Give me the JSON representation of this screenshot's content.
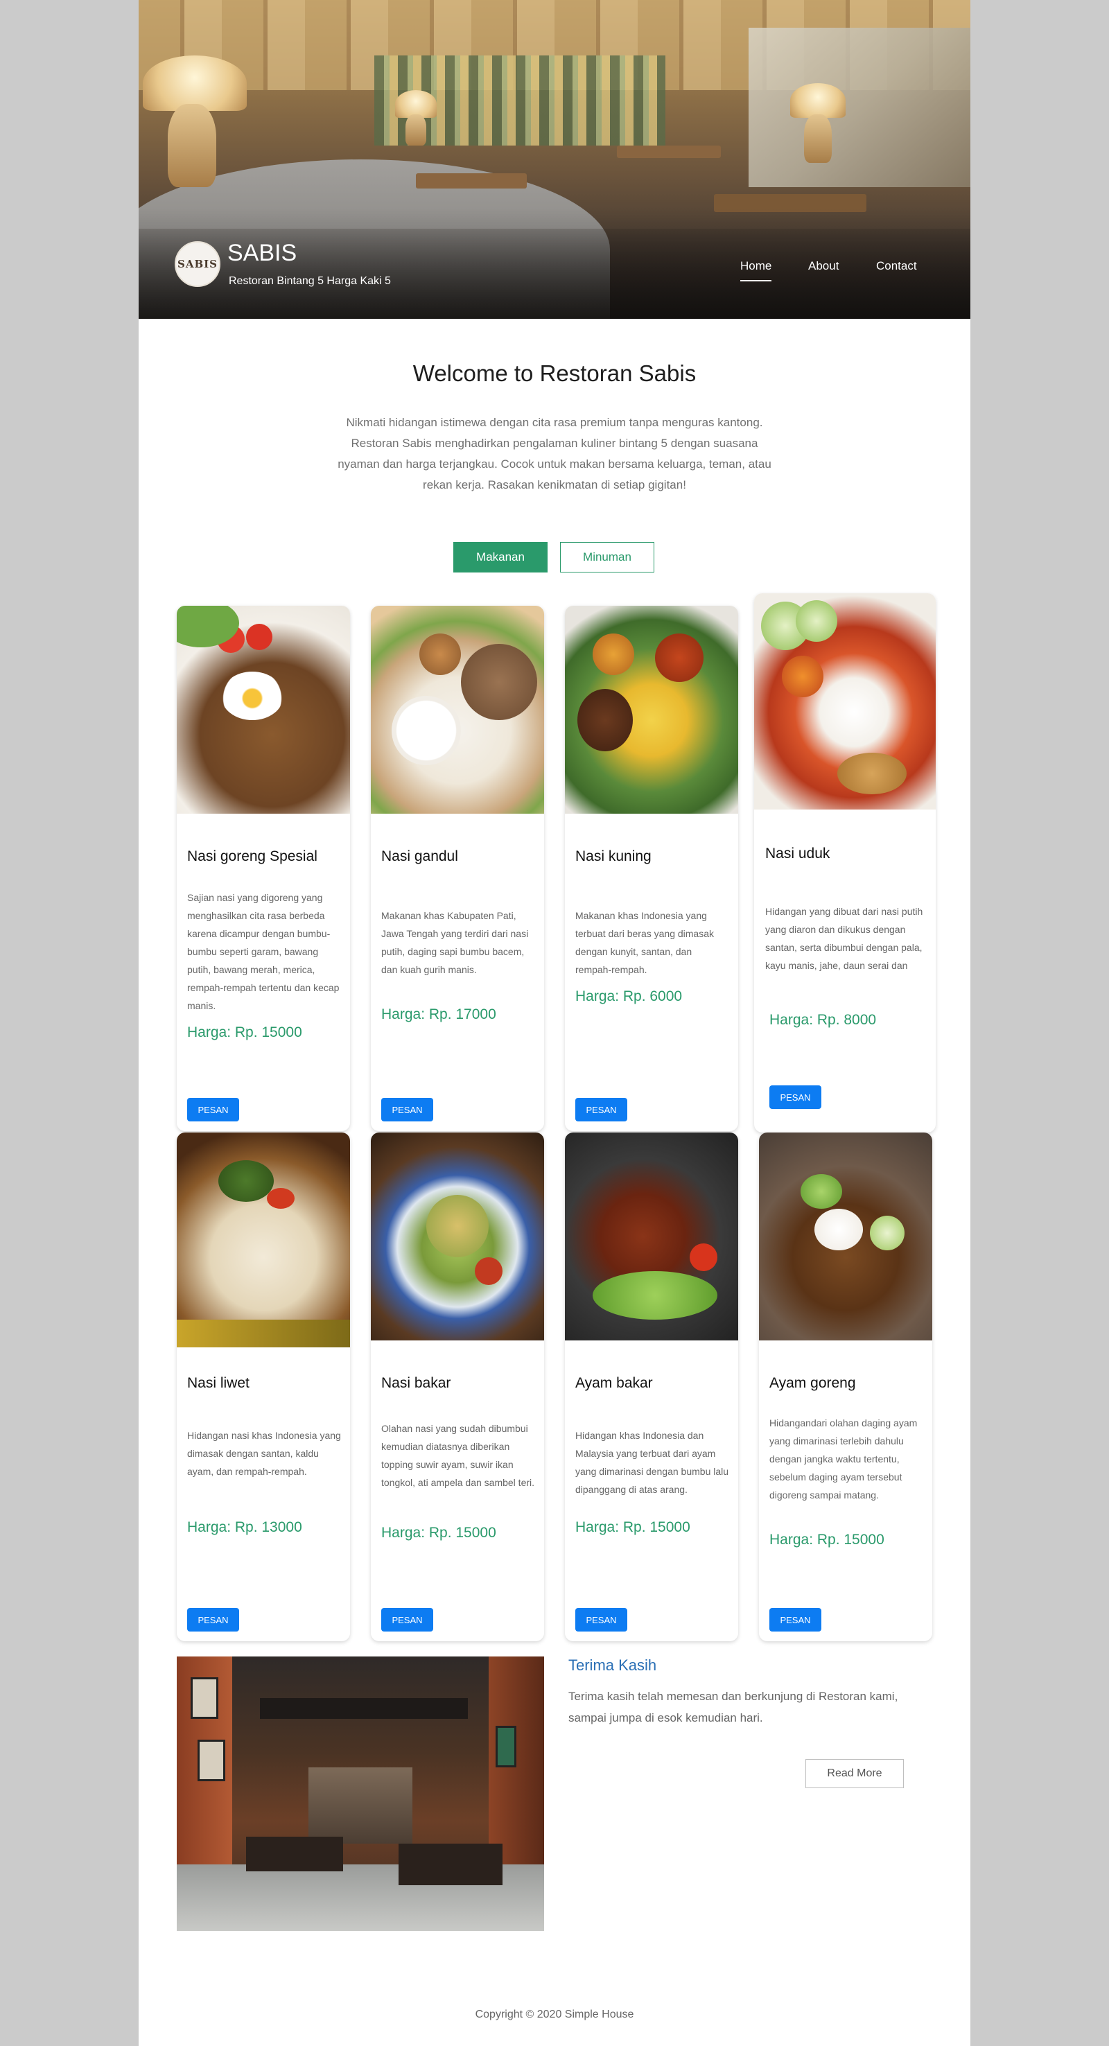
{
  "header": {
    "logo_text": "SABIS",
    "brand_title": "SABIS",
    "brand_tagline": "Restoran Bintang 5 Harga Kaki 5",
    "nav": [
      {
        "label": "Home",
        "active": true
      },
      {
        "label": "About",
        "active": false
      },
      {
        "label": "Contact",
        "active": false
      }
    ]
  },
  "welcome": {
    "title": "Welcome to Restoran Sabis",
    "text": "Nikmati hidangan istimewa dengan cita rasa premium tanpa menguras kantong. Restoran Sabis menghadirkan pengalaman kuliner bintang 5 dengan suasana nyaman dan harga terjangkau. Cocok untuk makan bersama keluarga, teman, atau rekan kerja. Rasakan kenikmatan di setiap gigitan!"
  },
  "tabs": [
    {
      "label": "Makanan",
      "active": true
    },
    {
      "label": "Minuman",
      "active": false
    }
  ],
  "menu": [
    {
      "name": "Nasi goreng Spesial",
      "desc": "Sajian nasi yang digoreng yang menghasilkan cita rasa berbeda karena dicampur dengan bumbu-bumbu seperti garam, bawang putih, bawang merah, merica, rempah-rempah tertentu dan kecap manis.",
      "price": "Harga: Rp. 15000",
      "button": "PESAN"
    },
    {
      "name": "Nasi gandul",
      "desc": "Makanan khas Kabupaten Pati, Jawa Tengah yang terdiri dari nasi putih, daging sapi bumbu bacem, dan kuah gurih manis.",
      "price": "Harga: Rp. 17000",
      "button": "PESAN"
    },
    {
      "name": "Nasi kuning",
      "desc": "Makanan khas Indonesia yang terbuat dari beras yang dimasak dengan kunyit, santan, dan rempah-rempah.",
      "price": "Harga: Rp. 6000",
      "button": "PESAN"
    },
    {
      "name": "Nasi uduk",
      "desc": "Hidangan yang dibuat dari nasi putih yang diaron dan dikukus dengan santan, serta dibumbui dengan pala, kayu manis, jahe, daun serai dan merica.",
      "price": "Harga: Rp. 8000",
      "button": "PESAN"
    },
    {
      "name": "Nasi liwet",
      "desc": "Hidangan nasi khas Indonesia yang dimasak dengan santan, kaldu ayam, dan rempah-rempah.",
      "price": "Harga: Rp. 13000",
      "button": "PESAN"
    },
    {
      "name": "Nasi bakar",
      "desc": "Olahan nasi yang sudah dibumbui kemudian diatasnya diberikan topping suwir ayam, suwir ikan tongkol, ati ampela dan sambel teri.",
      "price": "Harga: Rp. 15000",
      "button": "PESAN"
    },
    {
      "name": "Ayam bakar",
      "desc": "Hidangan khas Indonesia dan Malaysia yang terbuat dari ayam yang dimarinasi dengan bumbu lalu dipanggang di atas arang.",
      "price": "Harga: Rp. 15000",
      "button": "PESAN"
    },
    {
      "name": "Ayam goreng",
      "desc": "Hidangandari olahan daging ayam yang dimarinasi terlebih dahulu dengan jangka waktu tertentu, sebelum daging ayam tersebut digoreng sampai matang.",
      "price": "Harga: Rp. 15000",
      "button": "PESAN"
    }
  ],
  "thanks": {
    "title": "Terima Kasih",
    "text": "Terima kasih telah memesan dan berkunjung di Restoran kami, sampai jumpa di esok kemudian hari.",
    "button": "Read More"
  },
  "footer": {
    "copyright": "Copyright © 2020 Simple House"
  },
  "colors": {
    "accent": "#2a9a6b",
    "button": "#0d7cf2",
    "link": "#2a6fb5"
  }
}
